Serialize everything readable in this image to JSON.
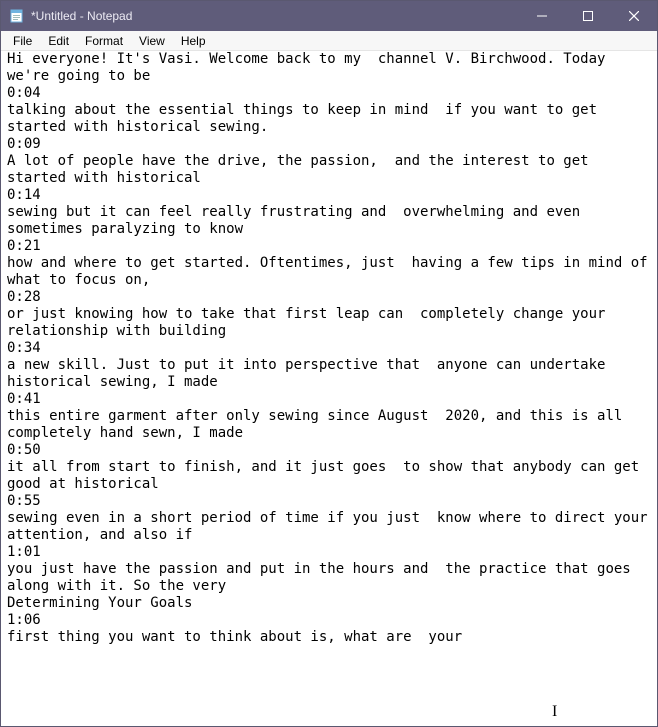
{
  "window": {
    "title": "*Untitled - Notepad"
  },
  "menubar": {
    "items": [
      "File",
      "Edit",
      "Format",
      "View",
      "Help"
    ]
  },
  "editor": {
    "content": "Hi everyone! It's Vasi. Welcome back to my  channel V. Birchwood. Today we're going to be\n0:04\ntalking about the essential things to keep in mind  if you want to get started with historical sewing.\n0:09\nA lot of people have the drive, the passion,  and the interest to get started with historical\n0:14\nsewing but it can feel really frustrating and  overwhelming and even sometimes paralyzing to know\n0:21\nhow and where to get started. Oftentimes, just  having a few tips in mind of what to focus on,\n0:28\nor just knowing how to take that first leap can  completely change your relationship with building\n0:34\na new skill. Just to put it into perspective that  anyone can undertake historical sewing, I made\n0:41\nthis entire garment after only sewing since August  2020, and this is all completely hand sewn, I made\n0:50\nit all from start to finish, and it just goes  to show that anybody can get good at historical\n0:55\nsewing even in a short period of time if you just  know where to direct your attention, and also if\n1:01\nyou just have the passion and put in the hours and  the practice that goes along with it. So the very\nDetermining Your Goals\n1:06\nfirst thing you want to think about is, what are  your"
  },
  "icons": {
    "minimize": "—",
    "maximize": "▢",
    "close": "✕"
  }
}
